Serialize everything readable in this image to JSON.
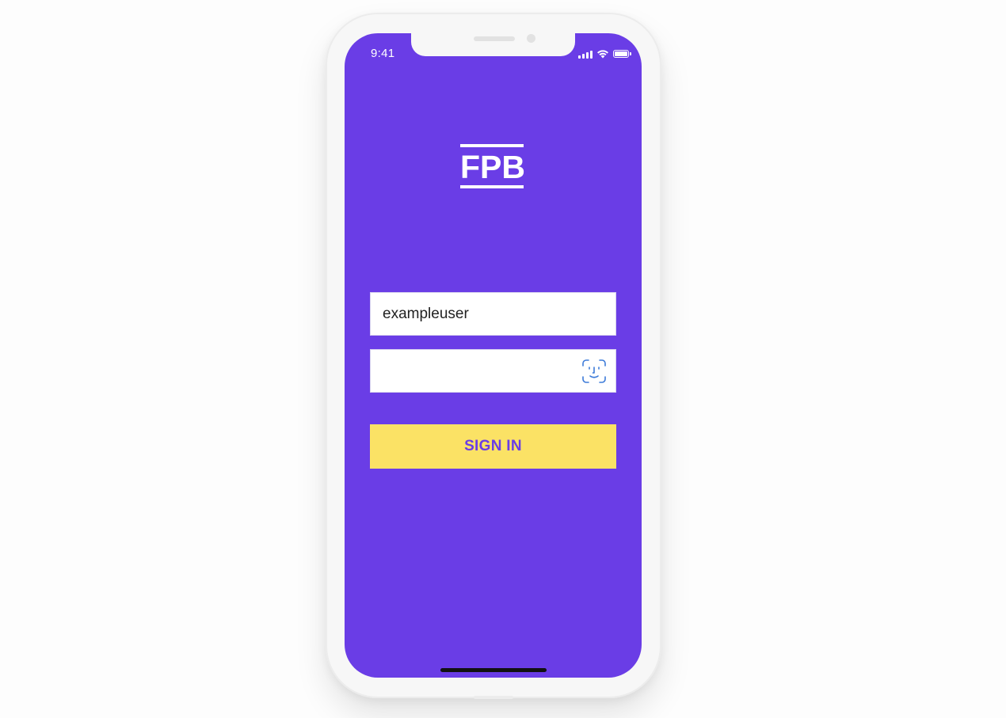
{
  "status_bar": {
    "time": "9:41",
    "icons": [
      "cellular-signal-icon",
      "wifi-icon",
      "battery-icon"
    ]
  },
  "logo": {
    "text": "FPB"
  },
  "login_form": {
    "username": {
      "value": "exampleuser",
      "placeholder": ""
    },
    "password": {
      "value": "",
      "placeholder": "",
      "icon": "face-id-icon"
    },
    "submit_label": "SIGN IN"
  },
  "colors": {
    "background": "#6a3de6",
    "button": "#fbe265",
    "button_text": "#6a3de6",
    "face_id_icon": "#3d7bd9"
  }
}
